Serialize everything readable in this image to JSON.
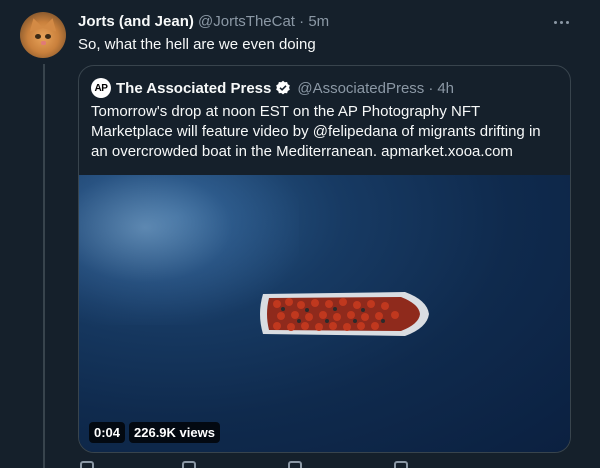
{
  "tweet": {
    "author_name": "Jorts (and Jean)",
    "author_handle": "@JortsTheCat",
    "separator": "·",
    "time": "5m",
    "text": "So, what the hell are we even doing"
  },
  "quoted_tweet": {
    "logo_text": "AP",
    "author_name": "The Associated Press",
    "author_handle": "@AssociatedPress",
    "separator": "·",
    "time": "4h",
    "text": "Tomorrow's drop at noon EST on the AP Photography NFT Marketplace will feature video by @felipedana of migrants drifting in an overcrowded boat in the Mediterranean. apmarket.xooa.com",
    "video": {
      "duration": "0:04",
      "views": "226.9K views"
    }
  },
  "icons": {
    "avatar": "cat-avatar",
    "more": "more-options-icon",
    "verified": "verified-badge-icon"
  },
  "colors": {
    "background": "#15202b",
    "border": "#38444d",
    "secondary_text": "#8b98a5",
    "verified": "#ffffff"
  }
}
